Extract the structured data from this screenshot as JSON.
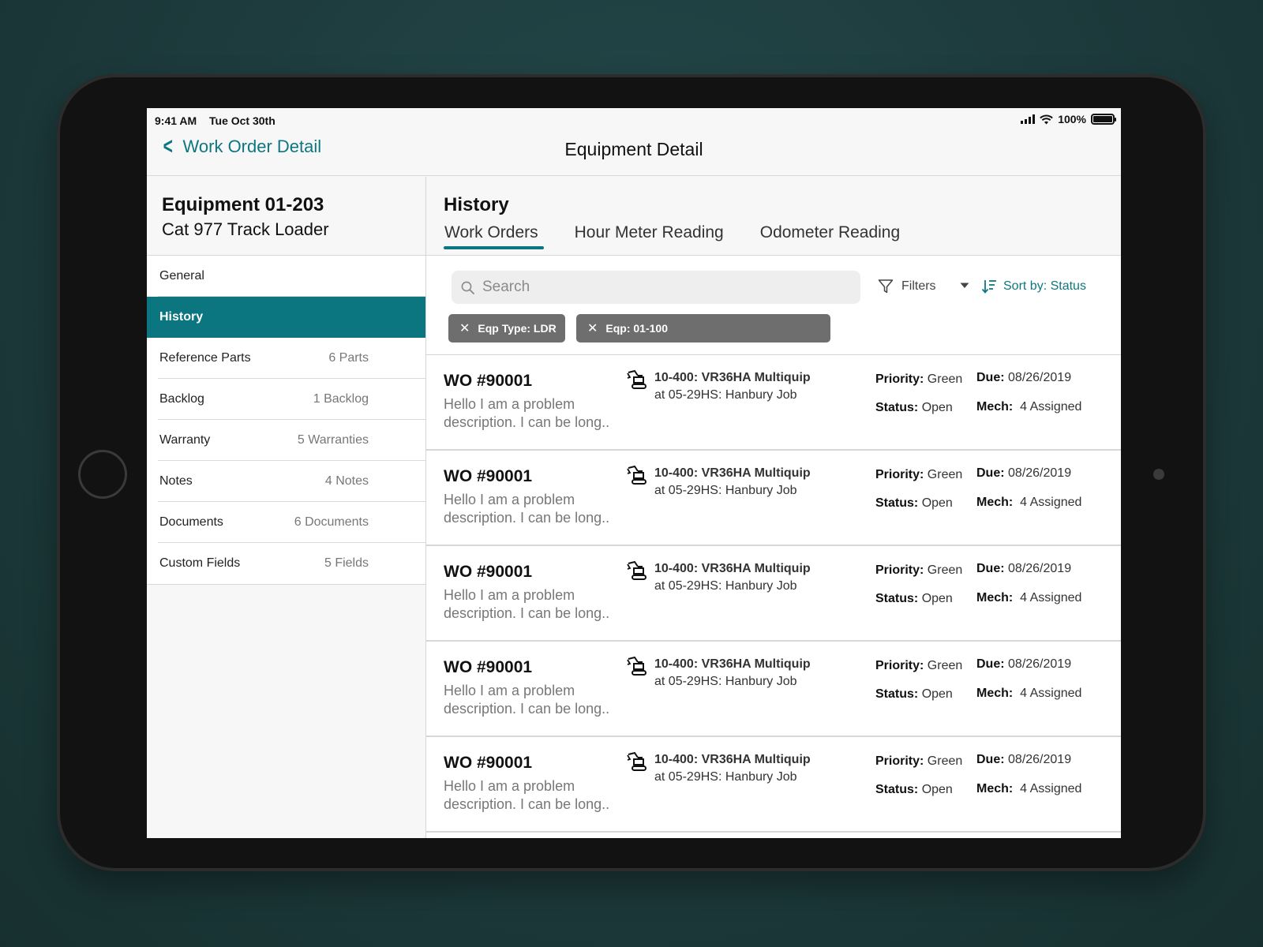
{
  "status_bar": {
    "time": "9:41 AM",
    "date": "Tue Oct 30th",
    "battery": "100%"
  },
  "nav": {
    "back_label": "Work Order Detail",
    "title": "Equipment Detail"
  },
  "equipment": {
    "id_title": "Equipment 01-203",
    "model": "Cat 977 Track Loader"
  },
  "menu": [
    {
      "label": "General",
      "count": ""
    },
    {
      "label": "History",
      "count": "",
      "active": true
    },
    {
      "label": "Reference Parts",
      "count": "6 Parts"
    },
    {
      "label": "Backlog",
      "count": "1 Backlog"
    },
    {
      "label": "Warranty",
      "count": "5 Warranties"
    },
    {
      "label": "Notes",
      "count": "4 Notes"
    },
    {
      "label": "Documents",
      "count": "6 Documents"
    },
    {
      "label": "Custom Fields",
      "count": "5 Fields"
    }
  ],
  "history": {
    "title": "History",
    "tabs": [
      "Work Orders",
      "Hour Meter Reading",
      "Odometer Reading"
    ],
    "active_tab": "Work Orders"
  },
  "toolbar": {
    "search_placeholder": "Search",
    "filters_label": "Filters",
    "sort_label": "Sort by: Status",
    "chips": [
      "Eqp Type: LDR",
      "Eqp: 01-100"
    ]
  },
  "work_orders": [
    {
      "number": "WO #90001",
      "description": "Hello I am a problem description. I can be long..",
      "equipment": "10-400: VR36HA Multiquip",
      "location": "at 05-29HS: Hanbury Job",
      "priority_label": "Priority:",
      "priority": "Green",
      "status_label": "Status:",
      "status": "Open",
      "due_label": "Due:",
      "due": "08/26/2019",
      "mech_label": "Mech:",
      "mech": "4 Assigned"
    },
    {
      "number": "WO #90001",
      "description": "Hello I am a problem description. I can be long..",
      "equipment": "10-400: VR36HA Multiquip",
      "location": "at 05-29HS: Hanbury Job",
      "priority_label": "Priority:",
      "priority": "Green",
      "status_label": "Status:",
      "status": "Open",
      "due_label": "Due:",
      "due": "08/26/2019",
      "mech_label": "Mech:",
      "mech": "4 Assigned"
    },
    {
      "number": "WO #90001",
      "description": "Hello I am a problem description. I can be long..",
      "equipment": "10-400: VR36HA Multiquip",
      "location": "at 05-29HS: Hanbury Job",
      "priority_label": "Priority:",
      "priority": "Green",
      "status_label": "Status:",
      "status": "Open",
      "due_label": "Due:",
      "due": "08/26/2019",
      "mech_label": "Mech:",
      "mech": "4 Assigned"
    },
    {
      "number": "WO #90001",
      "description": "Hello I am a problem description. I can be long..",
      "equipment": "10-400: VR36HA Multiquip",
      "location": "at 05-29HS: Hanbury Job",
      "priority_label": "Priority:",
      "priority": "Green",
      "status_label": "Status:",
      "status": "Open",
      "due_label": "Due:",
      "due": "08/26/2019",
      "mech_label": "Mech:",
      "mech": "4 Assigned"
    },
    {
      "number": "WO #90001",
      "description": "Hello I am a problem description. I can be long..",
      "equipment": "10-400: VR36HA Multiquip",
      "location": "at 05-29HS: Hanbury Job",
      "priority_label": "Priority:",
      "priority": "Green",
      "status_label": "Status:",
      "status": "Open",
      "due_label": "Due:",
      "due": "08/26/2019",
      "mech_label": "Mech:",
      "mech": "4 Assigned"
    }
  ],
  "colors": {
    "accent": "#0b7580",
    "chip": "#6e6e6e",
    "background": "#1d3a3c"
  },
  "icons": {
    "back": "chevron-left-icon",
    "search": "search-icon",
    "filter": "filter-icon",
    "dropdown": "caret-down-icon",
    "sort": "sort-icon",
    "equipment": "excavator-icon",
    "chip_remove": "close-icon"
  }
}
